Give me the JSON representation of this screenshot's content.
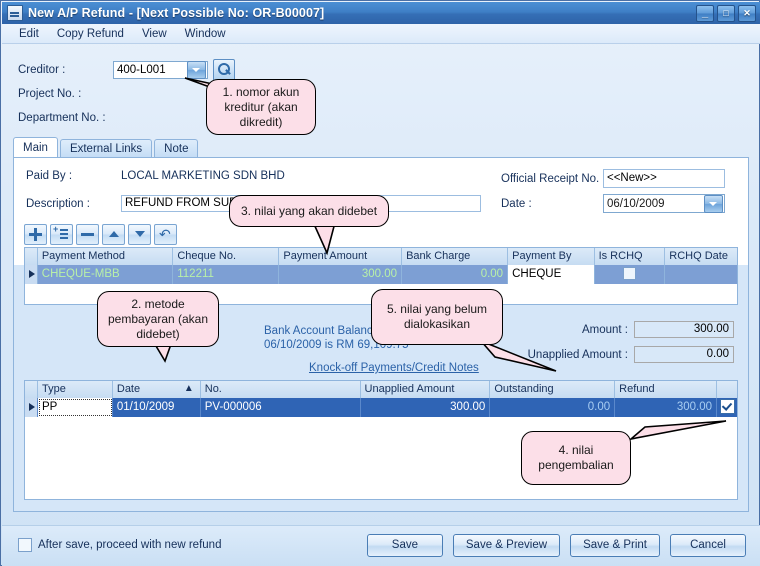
{
  "window": {
    "title": "New A/P Refund - [Next Possible No: OR-B00007]",
    "icon": "document-icon",
    "minimize": "_",
    "maximize": "□",
    "close": "✕"
  },
  "menu": [
    {
      "label": "Edit"
    },
    {
      "label": "Copy Refund"
    },
    {
      "label": "View"
    },
    {
      "label": "Window"
    }
  ],
  "header": {
    "creditor_label": "Creditor :",
    "creditor_value": "400-L001",
    "project_label": "Project No. :",
    "department_label": "Department No. :",
    "find_icon": "search-icon",
    "dropdown_icon": "chevron-down-icon"
  },
  "tabs": [
    {
      "label": "Main",
      "active": true
    },
    {
      "label": "External Links",
      "active": false
    },
    {
      "label": "Note",
      "active": false
    }
  ],
  "main": {
    "paid_by_label": "Paid By :",
    "paid_by_value": "LOCAL MARKETING SDN BHD",
    "description_label": "Description :",
    "description_value": "REFUND FROM SUPPLIER",
    "official_receipt_label": "Official Receipt No. :",
    "official_receipt_value": "<<New>>",
    "date_label": "Date :",
    "date_value": "06/10/2009"
  },
  "grid_toolbar": [
    {
      "icon": "add-row-icon"
    },
    {
      "icon": "insert-row-icon"
    },
    {
      "icon": "delete-row-icon"
    },
    {
      "icon": "move-up-icon"
    },
    {
      "icon": "move-down-icon"
    },
    {
      "icon": "undo-icon"
    }
  ],
  "payment_grid": {
    "columns": [
      "Payment Method",
      "Cheque No.",
      "Payment Amount",
      "Bank Charge",
      "Payment By",
      "Is RCHQ",
      "RCHQ Date"
    ],
    "rows": [
      {
        "payment_method": "CHEQUE-MBB",
        "cheque_no": "112211",
        "payment_amount": "300.00",
        "bank_charge": "0.00",
        "payment_by": "CHEQUE",
        "is_rchq": false,
        "rchq_date": ""
      }
    ]
  },
  "balance": {
    "line1": "Bank Account Balance as at",
    "line2": "06/10/2009 is RM 69,109.75",
    "knockoff_link": "Knock-off Payments/Credit Notes",
    "amount_label": "Amount :",
    "amount_value": "300.00",
    "unapplied_label": "Unapplied Amount :",
    "unapplied_value": "0.00"
  },
  "knockoff_grid": {
    "columns": [
      "Type",
      "Date",
      "No.",
      "Unapplied Amount",
      "Outstanding",
      "Refund"
    ],
    "sort_column": "Date",
    "sort_icon": "sort-asc-icon",
    "rows": [
      {
        "type": "PP",
        "date": "01/10/2009",
        "no": "PV-000006",
        "unapplied_amount": "300.00",
        "outstanding": "0.00",
        "refund": "300.00",
        "selected": true
      }
    ]
  },
  "footer": {
    "checkbox_label": "After save, proceed with new refund",
    "checkbox_checked": false,
    "buttons": [
      {
        "label": "Save"
      },
      {
        "label": "Save & Preview"
      },
      {
        "label": "Save & Print"
      },
      {
        "label": "Cancel"
      }
    ]
  },
  "callouts": [
    {
      "id": 1,
      "text": "1. nomor akun kreditur (akan dikredit)"
    },
    {
      "id": 2,
      "text": "2. metode pembayaran (akan didebet)"
    },
    {
      "id": 3,
      "text": "3. nilai yang akan didebet"
    },
    {
      "id": 5,
      "text": "5. nilai yang belum dialokasikan"
    },
    {
      "id": 4,
      "text": "4. nilai pengembalian"
    }
  ],
  "colors": {
    "title_bar": "#3f7fc6",
    "callout_fill": "#fcdfe8",
    "grid1_selected_row": "#7d9fd4",
    "grid2_selected_row": "#2f64b5",
    "link": "#2b62a8"
  }
}
